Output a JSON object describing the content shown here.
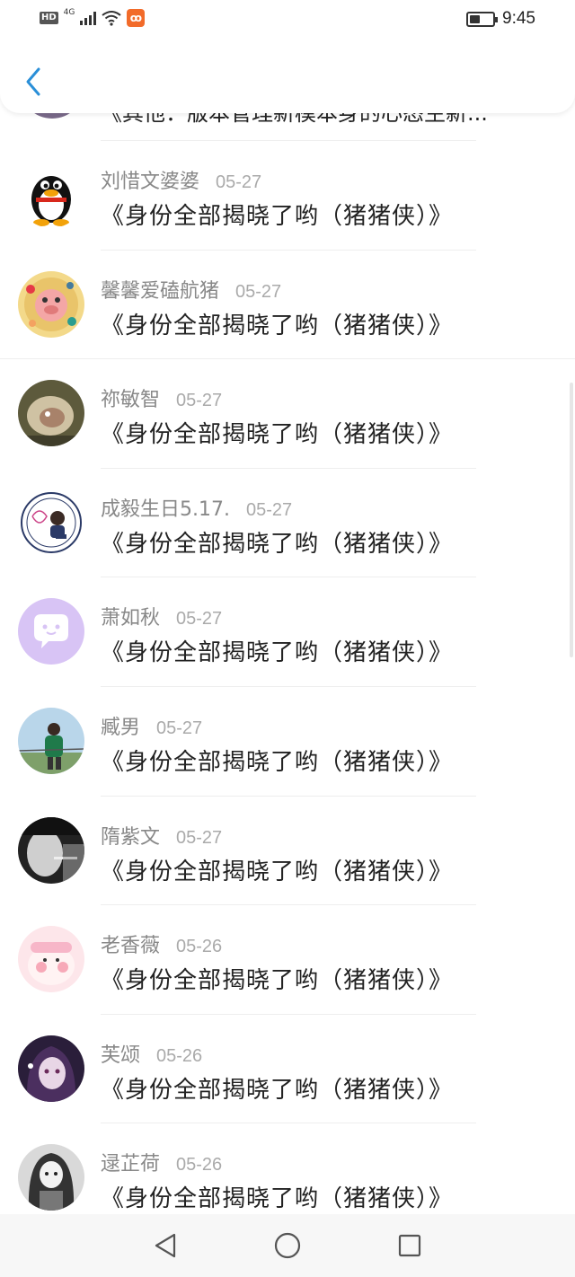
{
  "status_bar": {
    "hd": "HD",
    "network": "4G",
    "app_badge": "ꝏ",
    "time": "9:45"
  },
  "header": {
    "back_icon": "chevron-left-icon"
  },
  "partial_row": {
    "text": "《其他：版本管理新模本身的心态生新..."
  },
  "comments": [
    {
      "name": "刘惜文婆婆",
      "date": "05-27",
      "text": "《身份全部揭晓了哟（猪猪侠）》",
      "avatar": "penguin-avatar"
    },
    {
      "name": "馨馨爱磕航猪",
      "date": "05-27",
      "text": "《身份全部揭晓了哟（猪猪侠）》",
      "avatar": "cartoon-pig-avatar"
    },
    {
      "name": "祢敏智",
      "date": "05-27",
      "text": "《身份全部揭晓了哟（猪猪侠）》",
      "avatar": "food-photo-avatar"
    },
    {
      "name": "成毅生日5.17.",
      "date": "05-27",
      "text": "《身份全部揭晓了哟（猪猪侠）》",
      "avatar": "portrait-badge-avatar"
    },
    {
      "name": "萧如秋",
      "date": "05-27",
      "text": "《身份全部揭晓了哟（猪猪侠）》",
      "avatar": "chat-bubble-avatar"
    },
    {
      "name": "臧男",
      "date": "05-27",
      "text": "《身份全部揭晓了哟（猪猪侠）》",
      "avatar": "outdoor-person-avatar"
    },
    {
      "name": "隋紫文",
      "date": "05-27",
      "text": "《身份全部揭晓了哟（猪猪侠）》",
      "avatar": "bw-smoking-avatar"
    },
    {
      "name": "老香薇",
      "date": "05-26",
      "text": "《身份全部揭晓了哟（猪猪侠）》",
      "avatar": "pink-pig-avatar"
    },
    {
      "name": "芙颂",
      "date": "05-26",
      "text": "《身份全部揭晓了哟（猪猪侠）》",
      "avatar": "anime-dark-avatar"
    },
    {
      "name": "逯芷荷",
      "date": "05-26",
      "text": "《身份全部揭晓了哟（猪猪侠）》",
      "avatar": "anime-girl-avatar"
    }
  ],
  "nav_bar": {
    "back": "triangle-back-icon",
    "home": "circle-home-icon",
    "recents": "square-recents-icon"
  }
}
